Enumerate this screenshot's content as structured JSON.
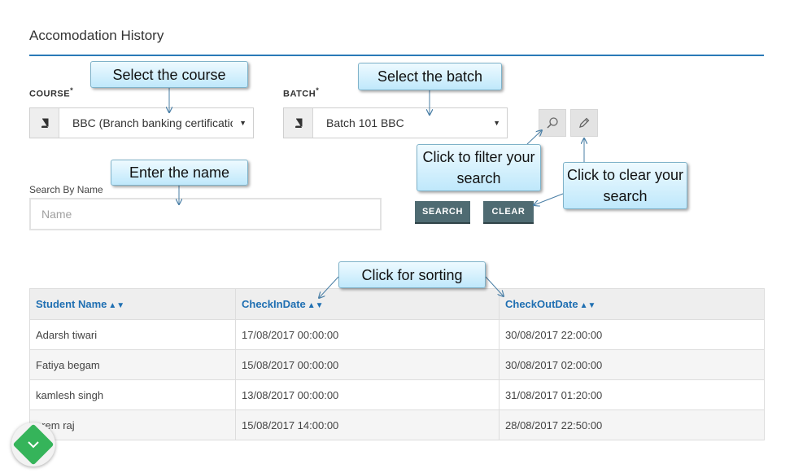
{
  "page": {
    "title": "Accomodation History"
  },
  "filters": {
    "course_label": "COURSE",
    "batch_label": "BATCH",
    "required_mark": "*",
    "course_value": "BBC (Branch banking certification",
    "batch_value": "Batch 101 BBC",
    "search_label": "Search By Name",
    "name_placeholder": "Name"
  },
  "buttons": {
    "search": "SEARCH",
    "clear": "CLEAR"
  },
  "table": {
    "columns": [
      "Student Name",
      "CheckInDate",
      "CheckOutDate"
    ],
    "rows": [
      [
        "Adarsh tiwari",
        "17/08/2017 00:00:00",
        "30/08/2017 22:00:00"
      ],
      [
        "Fatiya begam",
        "15/08/2017 00:00:00",
        "30/08/2017 02:00:00"
      ],
      [
        "kamlesh singh",
        "13/08/2017 00:00:00",
        "31/08/2017 01:20:00"
      ],
      [
        "prem raj",
        "15/08/2017 14:00:00",
        "28/08/2017 22:50:00"
      ]
    ]
  },
  "callouts": {
    "course": "Select the course",
    "batch": "Select the batch",
    "name": "Enter the name",
    "filter": "Click to filter your search",
    "clear": "Click to clear your search",
    "sort": "Click for sorting"
  },
  "icons": {
    "book": "book-icon",
    "search": "search-icon",
    "clear": "pencil-icon",
    "sort": "sort-icon",
    "float": "chevron-down-icon"
  },
  "colors": {
    "accent": "#2a7ab8",
    "header_text": "#1f6fb2",
    "button_bg": "#4f6b72",
    "callout_bg": "#bfe8fb",
    "float_btn": "#35b45a"
  }
}
